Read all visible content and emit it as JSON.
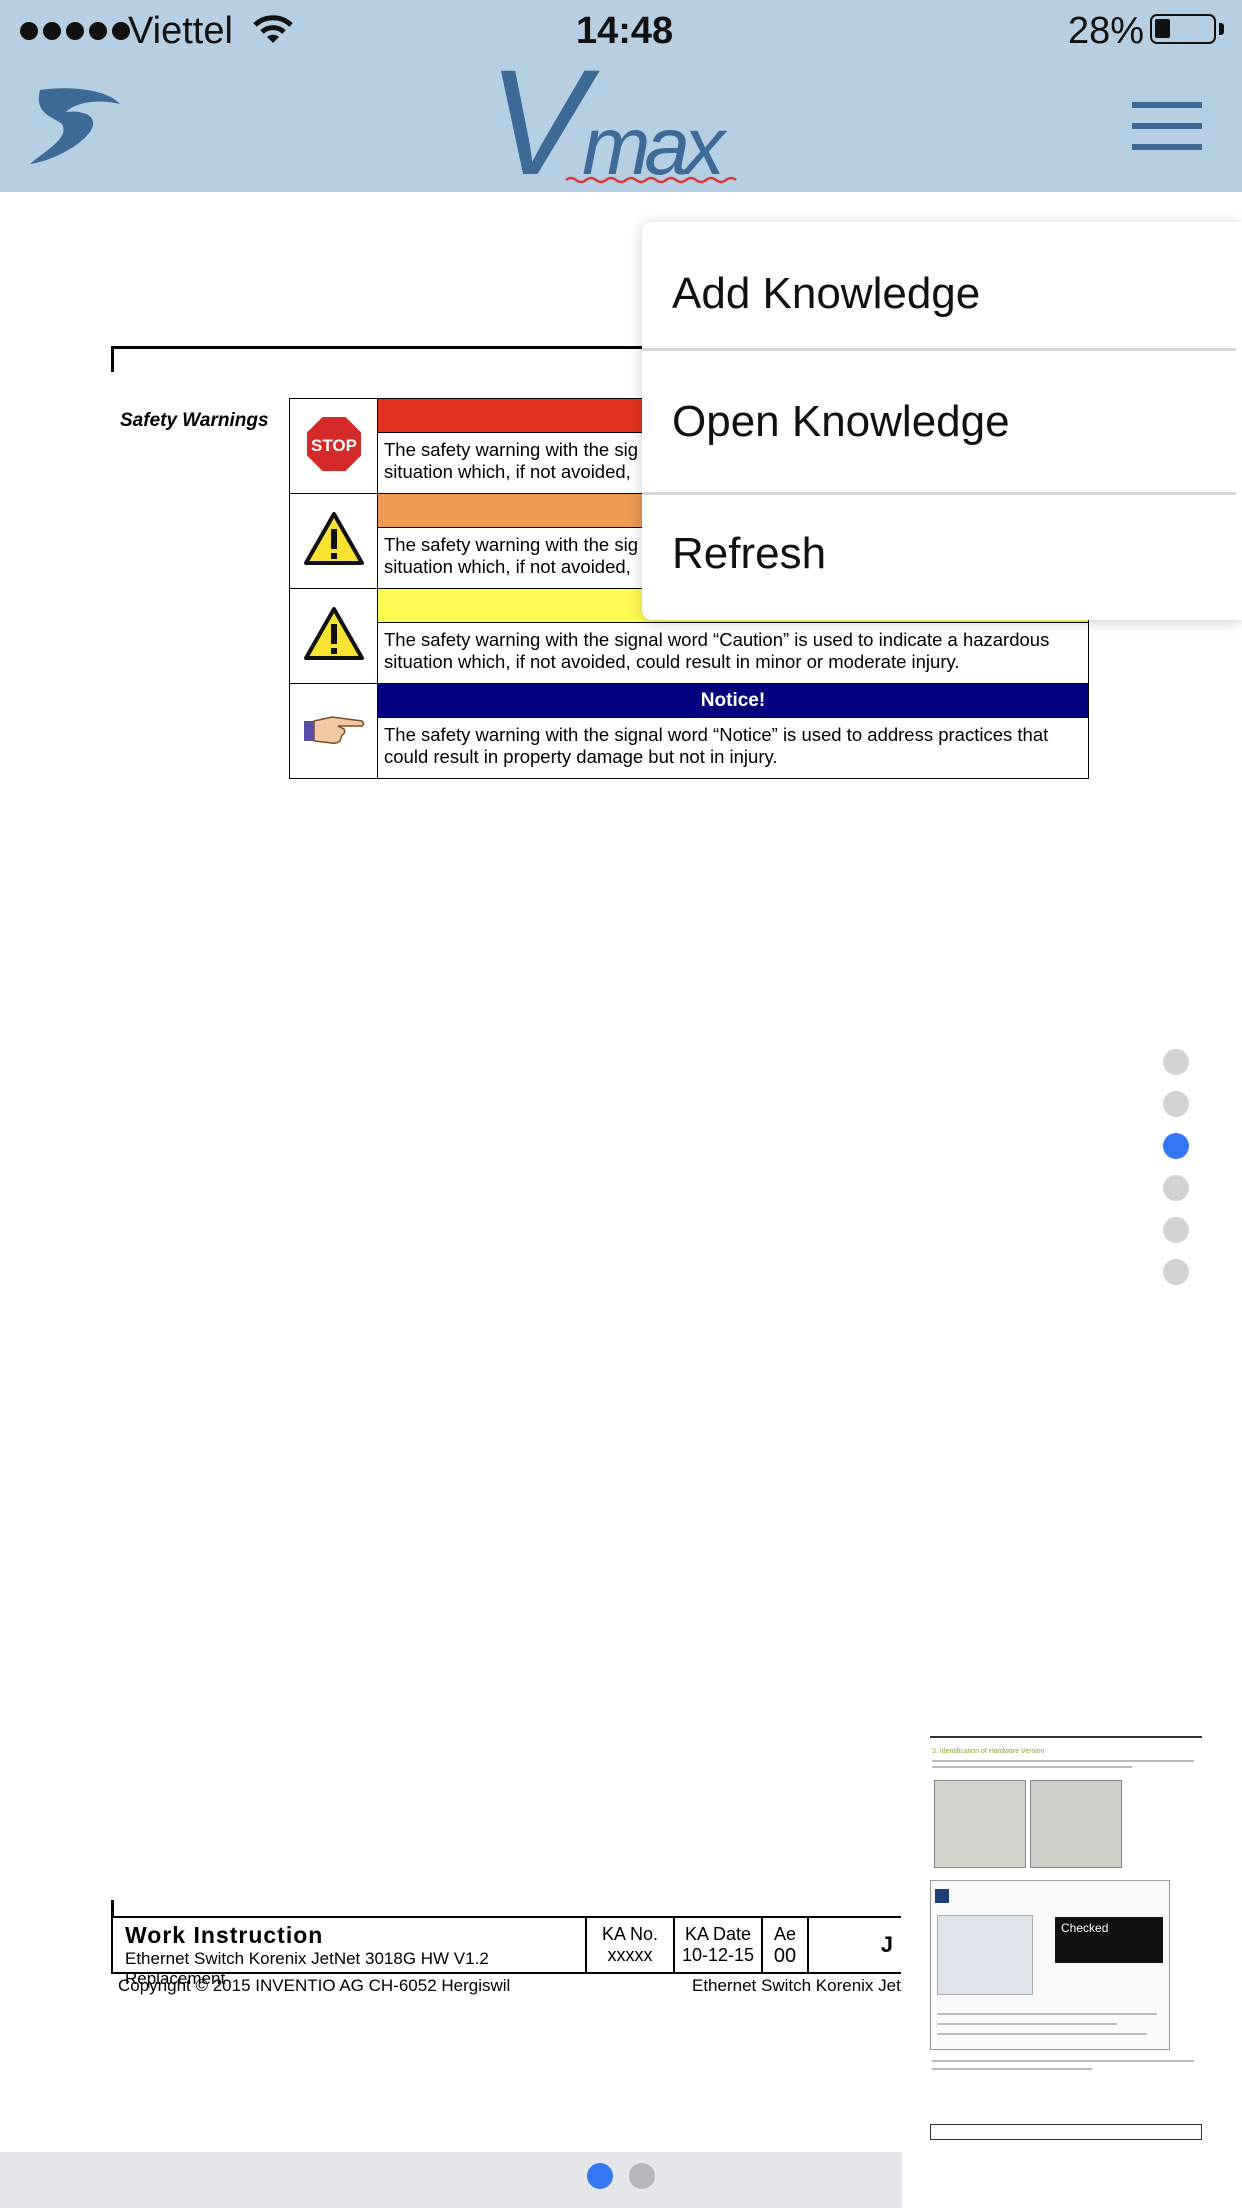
{
  "status_bar": {
    "carrier": "Viettel",
    "time": "14:48",
    "battery": "28%",
    "battery_level": 0.28,
    "signal_bars": 5
  },
  "header": {
    "logo_text": "Vmax",
    "brand_color": "#3d6a96",
    "bar_color": "#b7cfe3"
  },
  "menu": {
    "items": [
      {
        "label": "Add Knowledge"
      },
      {
        "label": "Open Knowledge"
      },
      {
        "label": "Refresh"
      }
    ]
  },
  "document": {
    "section_label": "Safety Warnings",
    "warnings": [
      {
        "level": "danger",
        "color": "#e43424",
        "icon": "stop-sign-icon",
        "text_line1": "The safety warning with the sig",
        "text_line2": "situation which, if not avoided,"
      },
      {
        "level": "warning",
        "color": "#ee9a55",
        "icon": "warning-triangle-icon",
        "text_line1": "The safety warning with the sig",
        "text_line2": "situation which, if not avoided,"
      },
      {
        "level": "caution",
        "color": "#fefc51",
        "icon": "warning-triangle-icon",
        "text_line1": "The safety warning with the signal word “Caution” is used to indicate a hazardous",
        "text_line2": "situation which, if not avoided, could result in minor or moderate injury."
      },
      {
        "level": "notice",
        "color": "#03037f",
        "icon": "pointing-hand-icon",
        "heading": "Notice!",
        "text_line1": "The safety warning with the signal word “Notice” is used to address practices that",
        "text_line2": "could result in property damage but not in injury."
      }
    ],
    "footer": {
      "title": "Work Instruction",
      "subtitle": "Ethernet Switch Korenix JetNet 3018G HW V1.2 Replacement",
      "ka_no_label": "KA No.",
      "ka_no_value": "xxxxx",
      "ka_date_label": "KA Date",
      "ka_date_value": "10-12-15",
      "ae_label": "Ae",
      "ae_value": "00",
      "code_fragment": "J",
      "copyright": "Copyright © 2015 INVENTIO AG   CH-6052  Hergiswil",
      "doc_name_fragment": "Ethernet Switch Korenix Jetl"
    }
  },
  "page_indicator": {
    "count": 6,
    "active_index": 2
  },
  "thumbnail": {
    "heading": "3. Identification of Hardware Version",
    "badge_text": "Checked"
  },
  "bottom_pager": {
    "count": 2,
    "active_index": 0
  }
}
